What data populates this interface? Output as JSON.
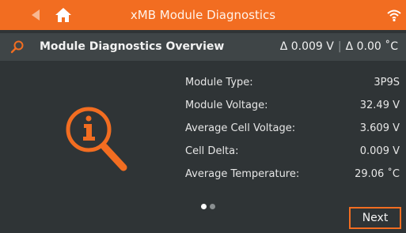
{
  "topbar": {
    "title": "xMB Module Diagnostics",
    "back_icon": "back-arrow-icon",
    "home_icon": "home-icon",
    "wifi_icon": "wifi-icon",
    "color": "#f26d21"
  },
  "header": {
    "icon": "search-icon",
    "title": "Module Diagnostics Overview",
    "delta_voltage": "Δ 0.009 V",
    "separator": "|",
    "delta_temp": "Δ 0.00 ˚C"
  },
  "main": {
    "icon": "info-magnifier-icon",
    "rows": [
      {
        "label": "Module Type:",
        "value": "3P9S"
      },
      {
        "label": "Module Voltage:",
        "value": "32.49 V"
      },
      {
        "label": "Average Cell Voltage:",
        "value": "3.609 V"
      },
      {
        "label": "Cell Delta:",
        "value": "0.009 V"
      },
      {
        "label": "Average Temperature:",
        "value": "29.06 ˚C"
      }
    ]
  },
  "pager": {
    "pages": 2,
    "current": 1
  },
  "footer": {
    "next_label": "Next"
  }
}
